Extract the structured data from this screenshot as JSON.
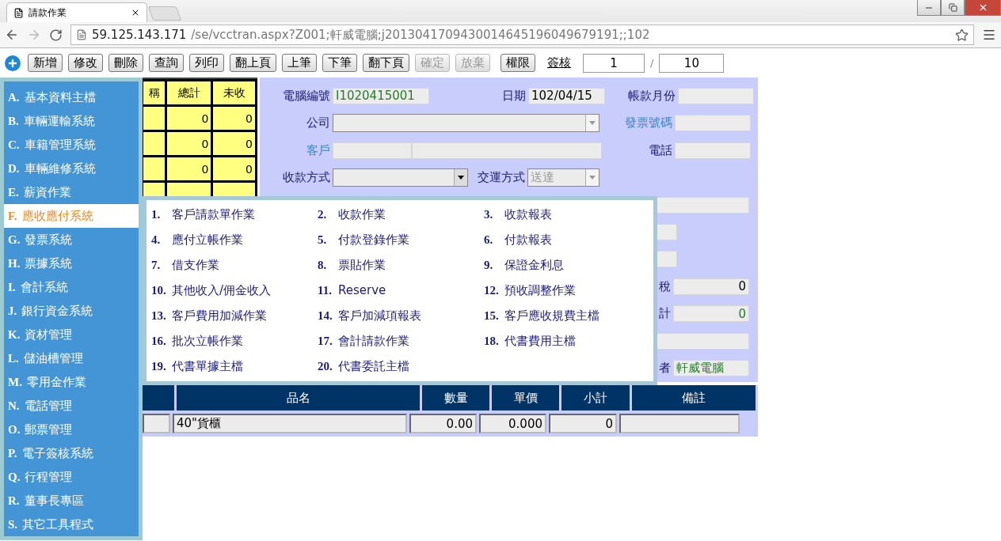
{
  "browser": {
    "tab": {
      "title": "請款作業"
    },
    "address": {
      "host": "59.125.143.171",
      "path": "/se/vcctran.aspx?Z001;軒威電腦;j2013041709430014645196049679191;;102"
    }
  },
  "toolbar": {
    "buttons": [
      {
        "label": "新增",
        "disabled": false
      },
      {
        "label": "修改",
        "disabled": false
      },
      {
        "label": "刪除",
        "disabled": false
      },
      {
        "label": "查詢",
        "disabled": false
      },
      {
        "label": "列印",
        "disabled": false
      },
      {
        "label": "翻上頁",
        "disabled": false
      },
      {
        "label": "上筆",
        "disabled": false
      },
      {
        "label": "下筆",
        "disabled": false
      },
      {
        "label": "翻下頁",
        "disabled": false
      },
      {
        "label": "確定",
        "disabled": true
      },
      {
        "label": "放棄",
        "disabled": true
      },
      {
        "label": "權限",
        "disabled": false
      }
    ],
    "sign_link": "簽核",
    "page": "1",
    "separator": "/",
    "total": "10"
  },
  "summary_table": {
    "columns": [
      "稱",
      "總計",
      "未收"
    ],
    "rows": [
      {
        "total": "0",
        "unpaid": "0"
      },
      {
        "total": "0",
        "unpaid": "0"
      },
      {
        "total": "0",
        "unpaid": "0"
      }
    ]
  },
  "form": {
    "computer_no": {
      "label": "電腦編號",
      "value": "I1020415001",
      "color": "#2a7a2a"
    },
    "date": {
      "label": "日期",
      "value": "102/04/15",
      "color": "#000000"
    },
    "account_month": {
      "label": "帳款月份"
    },
    "company": {
      "label": "公司"
    },
    "invoice_no": {
      "label": "發票號碼",
      "lookup": true
    },
    "customer": {
      "label": "客戶",
      "lookup": true
    },
    "phone": {
      "label": "電話",
      "lookup": false
    },
    "payment_method": {
      "label": "收款方式"
    },
    "shipping": {
      "label": "交運方式",
      "value": "送達",
      "disabled": true
    },
    "tax": {
      "label": "稅",
      "value": "0",
      "color": "#000000"
    },
    "total": {
      "label": "計",
      "value": "0",
      "color": "#2a7a2a"
    },
    "creator": {
      "label": "者",
      "value": "軒威電腦",
      "color": "#2a7a2a"
    }
  },
  "line_items": {
    "columns": [
      "品名",
      "數量",
      "單價",
      "小計",
      "備註"
    ],
    "rows": [
      {
        "name": "40\"貨櫃",
        "qty": "0.00",
        "price": "0.000",
        "subtotal": "0"
      }
    ]
  },
  "sidebar": {
    "items": [
      {
        "key": "A.",
        "label": "基本資料主檔",
        "selected": false
      },
      {
        "key": "B.",
        "label": "車輛運輸系統",
        "selected": false
      },
      {
        "key": "C.",
        "label": "車籍管理系統",
        "selected": false
      },
      {
        "key": "D.",
        "label": "車輛維修系統",
        "selected": false
      },
      {
        "key": "E.",
        "label": "薪資作業",
        "selected": false
      },
      {
        "key": "F.",
        "label": "應收應付系統",
        "selected": true
      },
      {
        "key": "G.",
        "label": "發票系統",
        "selected": false
      },
      {
        "key": "H.",
        "label": "票據系統",
        "selected": false
      },
      {
        "key": "I.",
        "label": "會計系統",
        "selected": false
      },
      {
        "key": "J.",
        "label": "銀行資金系統",
        "selected": false
      },
      {
        "key": "K.",
        "label": "資材管理",
        "selected": false
      },
      {
        "key": "L.",
        "label": "儲油槽管理",
        "selected": false
      },
      {
        "key": "M.",
        "label": "零用金作業",
        "selected": false
      },
      {
        "key": "N.",
        "label": "電話管理",
        "selected": false
      },
      {
        "key": "O.",
        "label": "郵票管理",
        "selected": false
      },
      {
        "key": "P.",
        "label": "電子簽核系統",
        "selected": false
      },
      {
        "key": "Q.",
        "label": "行程管理",
        "selected": false
      },
      {
        "key": "R.",
        "label": "董事長專區",
        "selected": false
      },
      {
        "key": "S.",
        "label": "其它工具程式",
        "selected": false
      }
    ]
  },
  "submenu": {
    "items": [
      {
        "number": "1.",
        "label": "客戶請款單作業"
      },
      {
        "number": "2.",
        "label": "收款作業"
      },
      {
        "number": "3.",
        "label": "收款報表"
      },
      {
        "number": "4.",
        "label": "應付立帳作業"
      },
      {
        "number": "5.",
        "label": "付款登錄作業"
      },
      {
        "number": "6.",
        "label": "付款報表"
      },
      {
        "number": "7.",
        "label": "借支作業"
      },
      {
        "number": "8.",
        "label": "票貼作業"
      },
      {
        "number": "9.",
        "label": "保證金利息"
      },
      {
        "number": "10.",
        "label": "其他收入/佣金收入"
      },
      {
        "number": "11.",
        "label": "Reserve"
      },
      {
        "number": "12.",
        "label": "預收調整作業"
      },
      {
        "number": "13.",
        "label": "客戶費用加減作業"
      },
      {
        "number": "14.",
        "label": "客戶加減項報表"
      },
      {
        "number": "15.",
        "label": "客戶應收規費主檔"
      },
      {
        "number": "16.",
        "label": "批次立帳作業"
      },
      {
        "number": "17.",
        "label": "會計請款作業"
      },
      {
        "number": "18.",
        "label": "代書費用主檔"
      },
      {
        "number": "19.",
        "label": "代書單據主檔"
      },
      {
        "number": "20.",
        "label": "代書委託主檔"
      }
    ]
  }
}
